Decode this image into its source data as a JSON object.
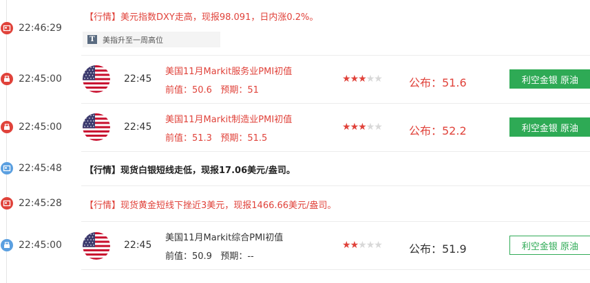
{
  "colors": {
    "red": "#e0423a",
    "green": "#2eaa55",
    "blue": "#5a9fe0",
    "grey": "#d8d8d8"
  },
  "items": [
    {
      "time": "22:46:29",
      "icon": "news-icon",
      "text": "【行情】美元指数DXY走高，现报98.091，日内涨0.2%。",
      "tag": "美指升至一周高位",
      "tag_icon": "T"
    },
    {
      "time": "22:45:00",
      "icon": "data-icon",
      "flag": "us-flag-icon",
      "event_time": "22:45",
      "name": "美国11月Markit服务业PMI初值",
      "prev": "前值：50.6   预期：51",
      "stars_on": 3,
      "stars_total": 5,
      "actual": "公布：51.6",
      "effect": "利空金银 原油"
    },
    {
      "time": "22:45:00",
      "icon": "data-icon",
      "flag": "us-flag-icon",
      "event_time": "22:45",
      "name": "美国11月Markit制造业PMI初值",
      "prev": "前值：51.3   预期：51.5",
      "stars_on": 3,
      "stars_total": 5,
      "actual": "公布：52.2",
      "effect": "利空金银 原油"
    },
    {
      "time": "22:45:48",
      "icon": "news-icon",
      "text": "【行情】现货白银短线走低，现报17.06美元/盎司。"
    },
    {
      "time": "22:45:28",
      "icon": "news-icon",
      "text": "【行情】现货黄金短线下挫近3美元，现报1466.66美元/盎司。"
    },
    {
      "time": "22:45:00",
      "icon": "data-icon",
      "flag": "us-flag-icon",
      "event_time": "22:45",
      "name": "美国11月Markit综合PMI初值",
      "prev": "前值：50.9   预期：--",
      "stars_on": 2,
      "stars_total": 5,
      "actual": "公布：51.9",
      "effect": "利空金银 原油"
    }
  ]
}
